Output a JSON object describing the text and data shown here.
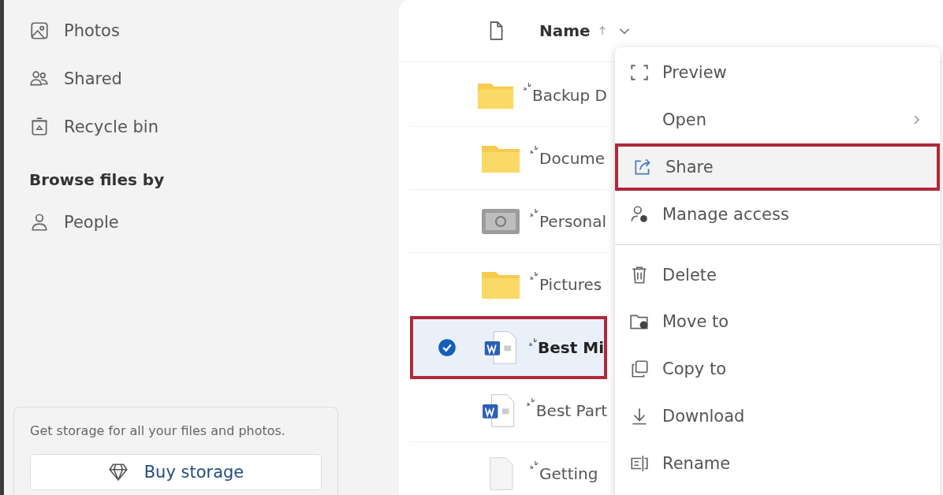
{
  "sidebar": {
    "items": [
      {
        "label": "Photos"
      },
      {
        "label": "Shared"
      },
      {
        "label": "Recycle bin"
      }
    ],
    "browse_heading": "Browse files by",
    "browse_items": [
      {
        "label": "People"
      }
    ],
    "storage_card": {
      "text": "Get storage for all your files and photos.",
      "button": "Buy storage"
    }
  },
  "file_list": {
    "column": "Name",
    "rows": [
      {
        "name": "Backup D",
        "kind": "folder",
        "selected": false,
        "highlighted": false
      },
      {
        "name": "Docume",
        "kind": "folder",
        "selected": false,
        "highlighted": false
      },
      {
        "name": "Personal",
        "kind": "vault",
        "selected": false,
        "highlighted": false
      },
      {
        "name": "Pictures",
        "kind": "folder",
        "selected": false,
        "highlighted": false
      },
      {
        "name": "Best Mi",
        "kind": "word",
        "selected": true,
        "highlighted": true
      },
      {
        "name": "Best Part",
        "kind": "word",
        "selected": false,
        "highlighted": false
      },
      {
        "name": "Getting",
        "kind": "document",
        "selected": false,
        "highlighted": false
      }
    ]
  },
  "context_menu": {
    "items": [
      {
        "label": "Preview",
        "submenu": false,
        "highlighted": false,
        "divider_before": false
      },
      {
        "label": "Open",
        "submenu": true,
        "highlighted": false,
        "divider_before": false
      },
      {
        "label": "Share",
        "submenu": false,
        "highlighted": true,
        "divider_before": false
      },
      {
        "label": "Manage access",
        "submenu": false,
        "highlighted": false,
        "divider_before": false
      },
      {
        "label": "Delete",
        "submenu": false,
        "highlighted": false,
        "divider_before": true
      },
      {
        "label": "Move to",
        "submenu": false,
        "highlighted": false,
        "divider_before": false
      },
      {
        "label": "Copy to",
        "submenu": false,
        "highlighted": false,
        "divider_before": false
      },
      {
        "label": "Download",
        "submenu": false,
        "highlighted": false,
        "divider_before": false
      },
      {
        "label": "Rename",
        "submenu": false,
        "highlighted": false,
        "divider_before": false
      }
    ]
  }
}
